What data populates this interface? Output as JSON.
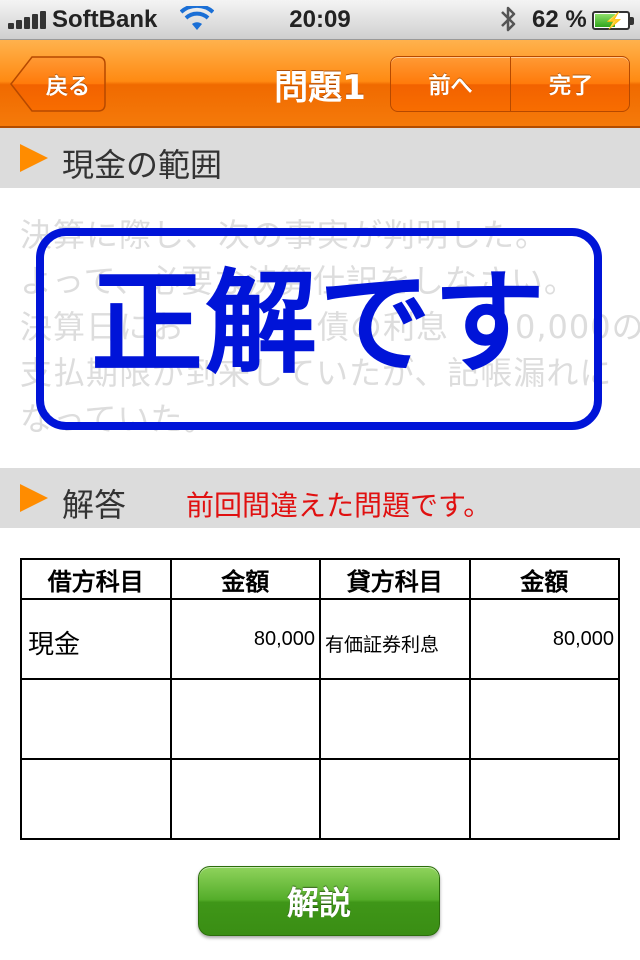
{
  "status_bar": {
    "carrier": "SoftBank",
    "time": "20:09",
    "battery_percent": "62 %",
    "battery_level": 0.62
  },
  "nav": {
    "back_label": "戻る",
    "title": "問題1",
    "prev_label": "前へ",
    "done_label": "完了",
    "accent_color": "#ff8a12"
  },
  "question_section": {
    "title": "現金の範囲",
    "body_lines": [
      "決算に際し、次の事実が判明した。",
      "よって、必要な決算仕訳をしなさい。",
      "決算日にお　　　　債の利息　　0,000の",
      "支払期限が到来していたが、記帳漏れに",
      "なっていた。"
    ]
  },
  "result_stamp": {
    "text": "正解です",
    "color": "#0014d8"
  },
  "answer_section": {
    "title": "解答",
    "note": "前回間違えた問題です。",
    "note_color": "#e01010"
  },
  "journal": {
    "headers": [
      "借方科目",
      "金額",
      "貸方科目",
      "金額"
    ],
    "rows": [
      {
        "debit_account": "現金",
        "debit_amount": "80,000",
        "credit_account": "有価証券利息",
        "credit_amount": "80,000"
      },
      {
        "debit_account": "",
        "debit_amount": "",
        "credit_account": "",
        "credit_amount": ""
      },
      {
        "debit_account": "",
        "debit_amount": "",
        "credit_account": "",
        "credit_amount": ""
      }
    ]
  },
  "explain_button": {
    "label": "解説",
    "color": "#4aa020"
  }
}
